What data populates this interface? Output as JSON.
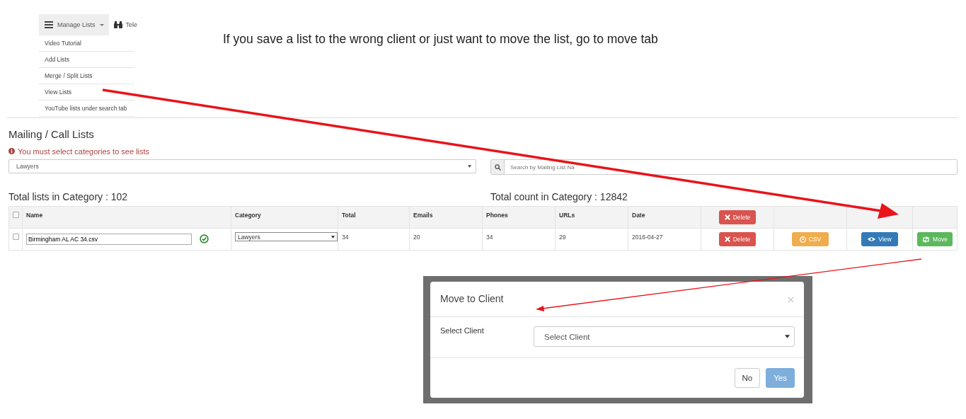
{
  "menu": {
    "tabs": [
      {
        "label": "Manage Lists",
        "caret": true,
        "selected": true
      },
      {
        "label": "Tele",
        "caret": false,
        "selected": false
      }
    ],
    "items": [
      "Video Tutorial",
      "Add Lists",
      "Merge / Split Lists",
      "View Lists",
      "YouTube lists under search tab"
    ]
  },
  "caption": "If you save a list to the wrong client or just want to move the list, go to move tab",
  "page": {
    "title": "Mailing / Call Lists",
    "warning": "You must select categories to see lists",
    "category_select": "Lawyers",
    "search": {
      "placeholder": "Search by Mailing List Na"
    },
    "total_lists": "Total lists in Category : 102",
    "total_count": "Total count in Category : 12842"
  },
  "table": {
    "select_all": {
      "checked": false
    },
    "columns": [
      "Name",
      "Category",
      "Total",
      "Emails",
      "Phones",
      "URLs",
      "Date"
    ],
    "header_actions": [
      {
        "kind": "delete",
        "label": "Delete"
      }
    ],
    "rows": [
      {
        "checked": false,
        "valid": true,
        "cells": [
          "Birmingham AL AC 34.csv",
          "Lawyers",
          "34",
          "20",
          "34",
          "29",
          "2016-04-27"
        ],
        "actions": [
          {
            "kind": "delete",
            "label": "Delete"
          },
          {
            "kind": "csv",
            "label": "CSV"
          },
          {
            "kind": "view",
            "label": "View"
          },
          {
            "kind": "move",
            "label": "Move"
          }
        ]
      }
    ]
  },
  "modal": {
    "title": "Move to Client",
    "field_label": "Select Client",
    "select": "Select Client",
    "buttons": [
      {
        "label": "No",
        "kind": "default",
        "disabled": false
      },
      {
        "label": "Yes",
        "kind": "primary",
        "disabled": true
      }
    ]
  }
}
